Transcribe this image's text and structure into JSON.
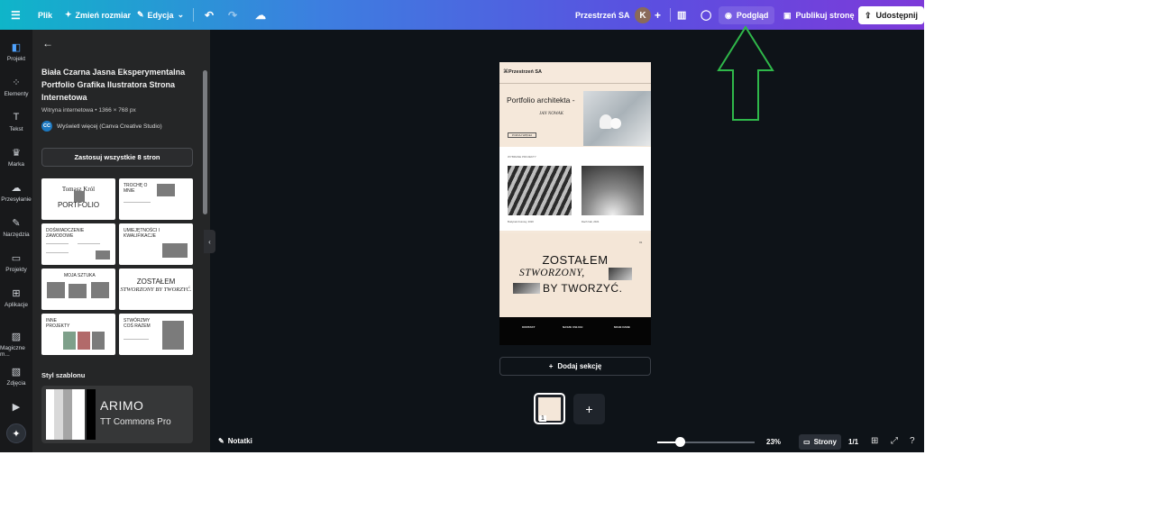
{
  "topbar": {
    "menu_icon": "hamburger-icon",
    "file": "Plik",
    "resize": "Zmień rozmiar",
    "edit": "Edycja",
    "workspace": "Przestrzeń SA",
    "avatar_letter": "K",
    "preview": "Podgląd",
    "publish": "Publikuj stronę",
    "share": "Udostępnij"
  },
  "rail": {
    "items": [
      {
        "label": "Projekt",
        "icon": "layout-icon"
      },
      {
        "label": "Elementy",
        "icon": "shapes-icon"
      },
      {
        "label": "Tekst",
        "icon": "text-icon"
      },
      {
        "label": "Marka",
        "icon": "brand-icon"
      },
      {
        "label": "Przesyłanie",
        "icon": "upload-icon"
      },
      {
        "label": "Narzędzia",
        "icon": "tools-icon"
      },
      {
        "label": "Projekty",
        "icon": "folder-icon"
      },
      {
        "label": "Aplikacje",
        "icon": "apps-icon"
      },
      {
        "label": "Magiczne m...",
        "icon": "magic-media-icon"
      },
      {
        "label": "Zdjęcia",
        "icon": "photos-icon"
      }
    ]
  },
  "panel": {
    "title": "Biała Czarna Jasna Eksperymentalna Portfolio Grafika Ilustratora Strona Internetowa",
    "meta": "Witryna internetowa • 1366 × 768 px",
    "creator_badge": "CC",
    "creator": "Wyświetl więcej (Canva Creative Studio)",
    "apply_all": "Zastosuj wszystkie 8 stron",
    "thumbs": [
      {
        "t1": "Tomasz Król",
        "t2": "PORTFOLIO"
      },
      {
        "t1": "TROCHĘ O MNIE",
        "t2": ""
      },
      {
        "t1": "DOŚWIADCZENIE ZAWODOWE",
        "t2": ""
      },
      {
        "t1": "UMIEJĘTNOŚCI I KWALIFIKACJE",
        "t2": ""
      },
      {
        "t1": "MOJA SZTUKA",
        "t2": ""
      },
      {
        "t1": "ZOSTAŁEM",
        "t2": "STWORZONY BY TWORZYĆ."
      },
      {
        "t1": "INNE PROJEKTY",
        "t2": ""
      },
      {
        "t1": "STWÓRZMY COŚ RAZEM",
        "t2": ""
      }
    ],
    "style_label": "Styl szablonu",
    "font_primary": "ARIMO",
    "font_secondary": "TT Commons Pro"
  },
  "canvas": {
    "brand": "Przestrzeń SA",
    "hero_title": "Portfolio architekta -",
    "hero_sub": "JAN NOWAK",
    "hero_button": "POZNAJ WIĘCEJ",
    "section_label": "WYBRANE PROJEKTY",
    "caption1": "Budynek biurowy, 2020",
    "caption2": "Dach hali, 2021",
    "page_no": "01",
    "made1": "ZOSTAŁEM",
    "made2": "STWORZONY,",
    "made3": "BY TWORZYĆ.",
    "footer": [
      "KONTAKT",
      "NASZE USŁUGI",
      "MOJE DANE"
    ],
    "add_section": "Dodaj sekcję",
    "page_thumb_num": "1"
  },
  "bottombar": {
    "notes": "Notatki",
    "zoom": "23%",
    "zoom_fraction": 0.23,
    "pages": "Strony",
    "page_count": "1/1"
  },
  "colors": {
    "topbar_gradient": [
      "#0fb5c9",
      "#7d3ad9"
    ],
    "annotation_arrow": "#2fb84a"
  }
}
